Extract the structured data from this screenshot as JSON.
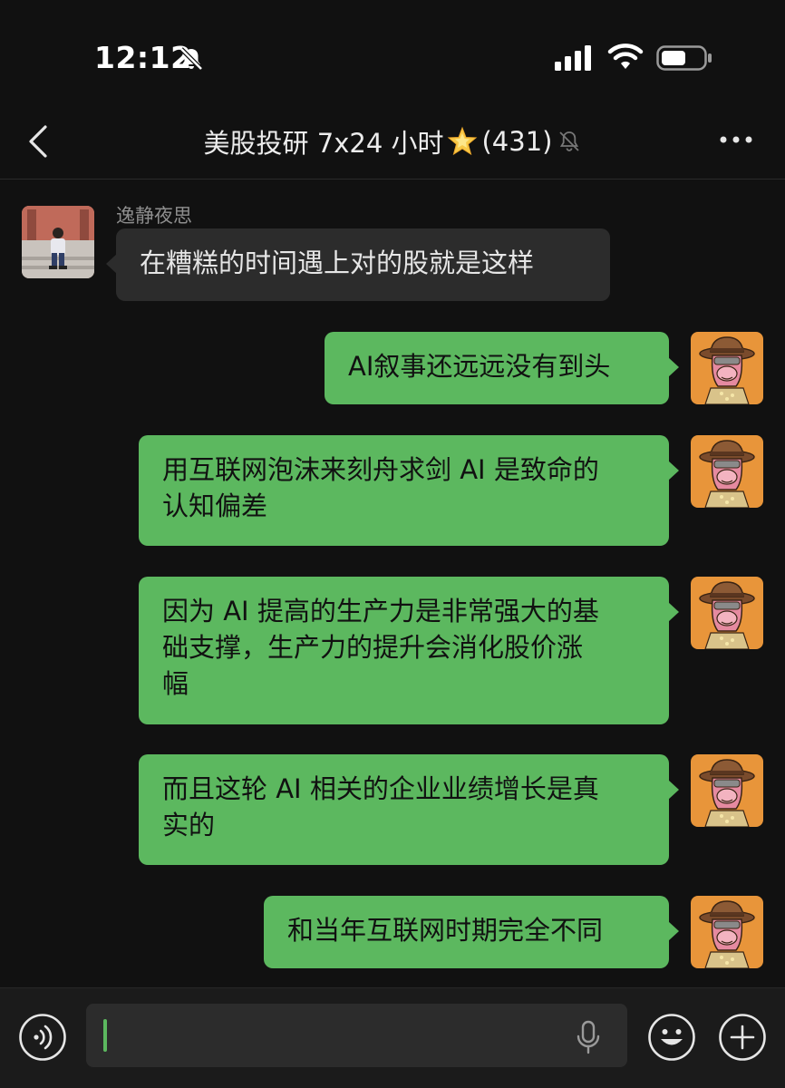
{
  "status_bar": {
    "time": "12:12",
    "icons": [
      "bell-off-icon",
      "cellular-signal-icon",
      "wifi-icon",
      "battery-icon"
    ]
  },
  "nav": {
    "title": "美股投研 7x24 小时",
    "title_emoji": "star-icon",
    "member_count": "(431)",
    "muted": true
  },
  "messages": [
    {
      "direction": "in",
      "sender": "逸静夜思",
      "text": "在糟糕的时间遇上对的股就是这样"
    },
    {
      "direction": "out",
      "text": "AI叙事还远远没有到头"
    },
    {
      "direction": "out",
      "lines": [
        "用互联网泡沫来刻舟求剑 AI 是致命的",
        "认知偏差"
      ]
    },
    {
      "direction": "out",
      "lines": [
        "因为 AI 提高的生产力是非常强大的基",
        "础支撑，生产力的提升会消化股价涨",
        "幅"
      ]
    },
    {
      "direction": "out",
      "lines": [
        "而且这轮 AI 相关的企业业绩增长是真",
        "实的"
      ]
    },
    {
      "direction": "out",
      "text": "和当年互联网时期完全不同"
    }
  ],
  "input_bar": {
    "value": "",
    "placeholder": ""
  },
  "colors": {
    "background": "#111111",
    "bubble_out": "#5cb85f",
    "bubble_in": "#2c2c2c",
    "input_bar": "#1b1b1b"
  }
}
